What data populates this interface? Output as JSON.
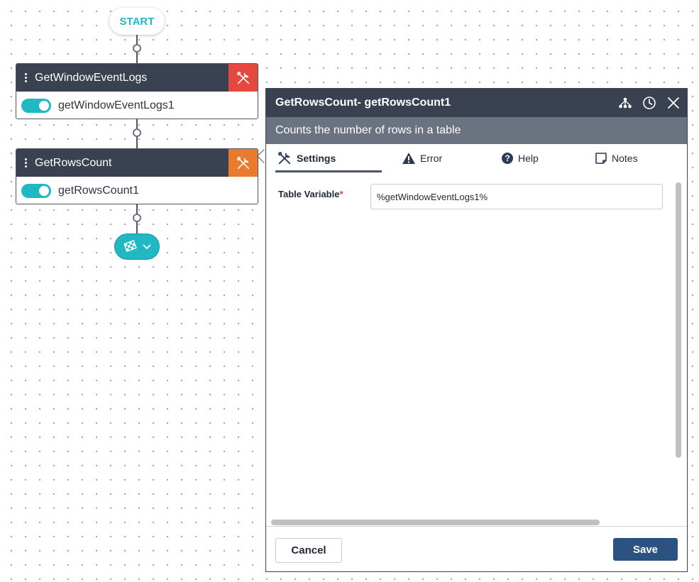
{
  "flow": {
    "start_label": "START",
    "nodes": [
      {
        "type_label": "GetWindowEventLogs",
        "instance_name": "getWindowEventLogs1",
        "tool_color": "#e5483f",
        "enabled": true
      },
      {
        "type_label": "GetRowsCount",
        "instance_name": "getRowsCount1",
        "tool_color": "#ea7b2c",
        "enabled": true
      }
    ],
    "end_icon": "checkered-flag-icon",
    "accent_color": "#1fb8c3"
  },
  "panel": {
    "title": "GetRowsCount-  getRowsCount1",
    "subtitle": "Counts the number of rows in a table",
    "header_icons": [
      "hierarchy-icon",
      "clock-icon",
      "close-icon"
    ],
    "tabs": [
      {
        "label": "Settings",
        "icon": "tools-icon",
        "active": true
      },
      {
        "label": "Error",
        "icon": "warning-icon",
        "active": false
      },
      {
        "label": "Help",
        "icon": "question-icon",
        "active": false
      },
      {
        "label": "Notes",
        "icon": "note-icon",
        "active": false
      }
    ],
    "fields": [
      {
        "label": "Table Variable",
        "required_mark": "*",
        "value": "%getWindowEventLogs1%"
      }
    ],
    "cancel_label": "Cancel",
    "save_label": "Save",
    "header_color": "#3a4150",
    "subheader_color": "#6b7280",
    "save_color": "#2c5282"
  }
}
